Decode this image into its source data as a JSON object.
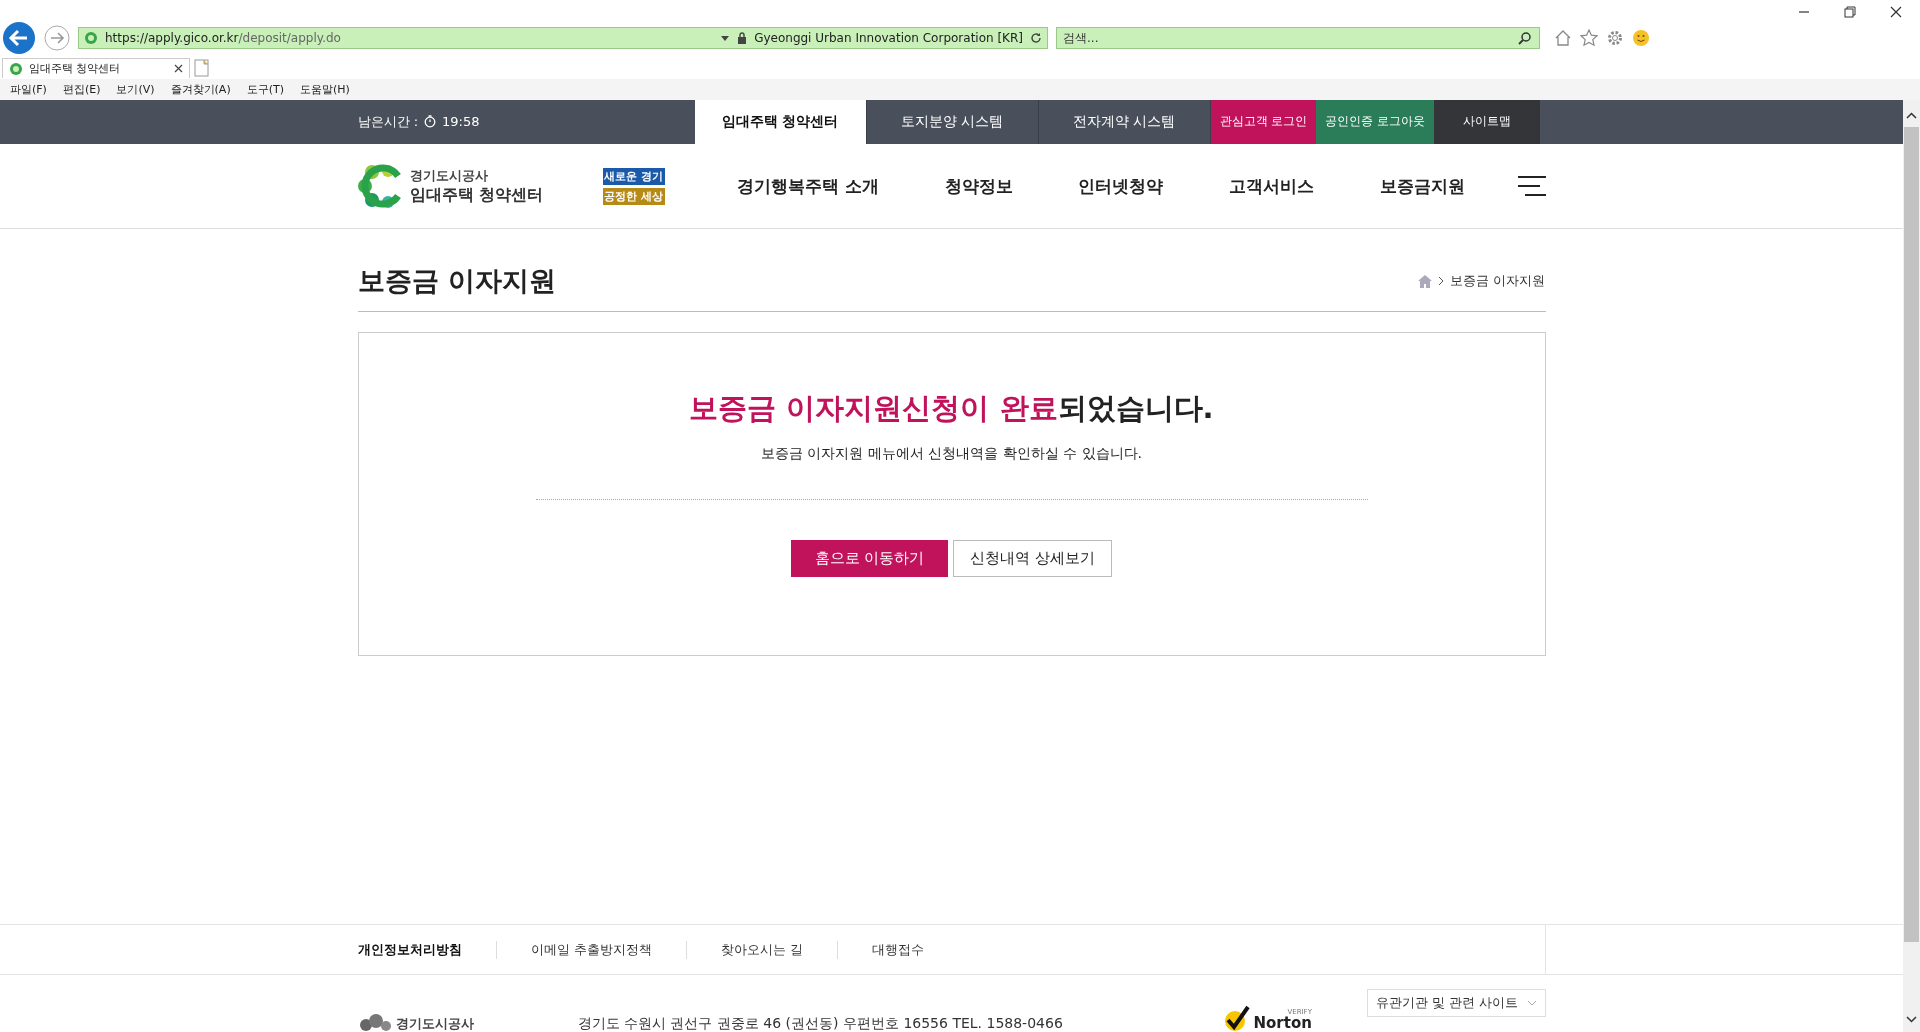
{
  "browser": {
    "url_host": "https://apply.gico.or.kr",
    "url_path": "/deposit/apply.do",
    "site_identity": "Gyeonggi Urban Innovation Corporation [KR]",
    "search": {
      "placeholder": "검색..."
    },
    "tab": {
      "title": "임대주택 청약센터"
    },
    "menu": [
      "파일(F)",
      "편집(E)",
      "보기(V)",
      "즐겨찾기(A)",
      "도구(T)",
      "도움말(H)"
    ]
  },
  "top_bar": {
    "timer_label": "남은시간 :",
    "timer_value": "19:58",
    "tabs": [
      {
        "label": "임대주택 청약센터",
        "selected": true
      },
      {
        "label": "토지분양 시스템",
        "selected": false
      },
      {
        "label": "전자계약 시스템",
        "selected": false
      }
    ],
    "utility": [
      {
        "label": "관심고객 로그인",
        "color": "#c0135c"
      },
      {
        "label": "공인인증 로그아웃",
        "color": "#2b7d5a"
      },
      {
        "label": "사이트맵",
        "color": "#333539"
      }
    ]
  },
  "header": {
    "logo_top": "경기도시공사",
    "logo_bottom": "임대주택 청약센터",
    "slogan_top": "새로운 경기",
    "slogan_bottom": "공정한 세상",
    "nav": [
      "경기행복주택 소개",
      "청약정보",
      "인터넷청약",
      "고객서비스",
      "보증금지원"
    ]
  },
  "page": {
    "title": "보증금 이자지원",
    "breadcrumb": "보증금 이자지원"
  },
  "result": {
    "headline_highlight": "보증금 이자지원신청이 완료",
    "headline_rest": "되었습니다.",
    "message": "보증금 이자지원 메뉴에서 신청내역을 확인하실 수 있습니다.",
    "buttons": [
      {
        "label": "홈으로 이동하기",
        "kind": "primary"
      },
      {
        "label": "신청내역 상세보기",
        "kind": "secondary"
      }
    ]
  },
  "footer": {
    "links": [
      {
        "label": "개인정보처리방침",
        "bold": true
      },
      {
        "label": "이메일 추출방지정책",
        "bold": false
      },
      {
        "label": "찾아오시는 길",
        "bold": false
      },
      {
        "label": "대행접수",
        "bold": false
      }
    ],
    "logo": "경기도시공사",
    "address": "경기도 수원시 권선구 권중로 46 (권선동) 우편번호 16556 TEL. 1588-0466",
    "norton_verify": "VERIFY",
    "norton_name": "Norton",
    "related_sites": "유관기관 및 관련 사이트"
  }
}
